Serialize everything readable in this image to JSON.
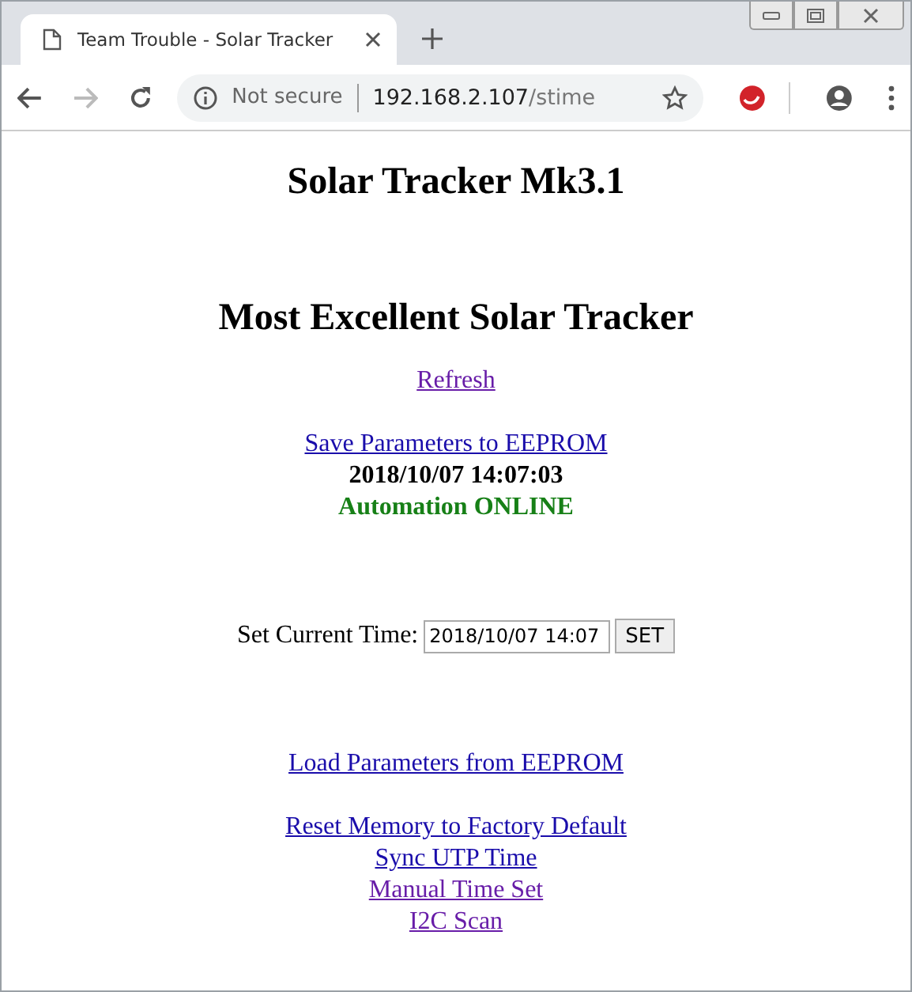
{
  "browser": {
    "tab": {
      "title": "Team Trouble - Solar Tracker"
    },
    "address": {
      "security": "Not secure",
      "host": "192.168.2.107",
      "path": "/stime"
    }
  },
  "page": {
    "title": "Solar Tracker Mk3.1",
    "heading": "Most Excellent Solar Tracker",
    "refresh_link": {
      "label": "Refresh",
      "visited": true
    },
    "save_link": {
      "label": "Save Parameters to EEPROM",
      "visited": false
    },
    "datetime": "2018/10/07 14:07:03",
    "status": "Automation ONLINE",
    "time_form": {
      "label": "Set Current Time:",
      "value": "2018/10/07 14:07",
      "button": "SET"
    },
    "load_link": {
      "label": "Load Parameters from EEPROM",
      "visited": false
    },
    "links": [
      {
        "label": "Reset Memory to Factory Default",
        "visited": false
      },
      {
        "label": "Sync UTP Time",
        "visited": false
      },
      {
        "label": "Manual Time Set",
        "visited": true
      },
      {
        "label": "I2C Scan",
        "visited": true
      }
    ]
  }
}
